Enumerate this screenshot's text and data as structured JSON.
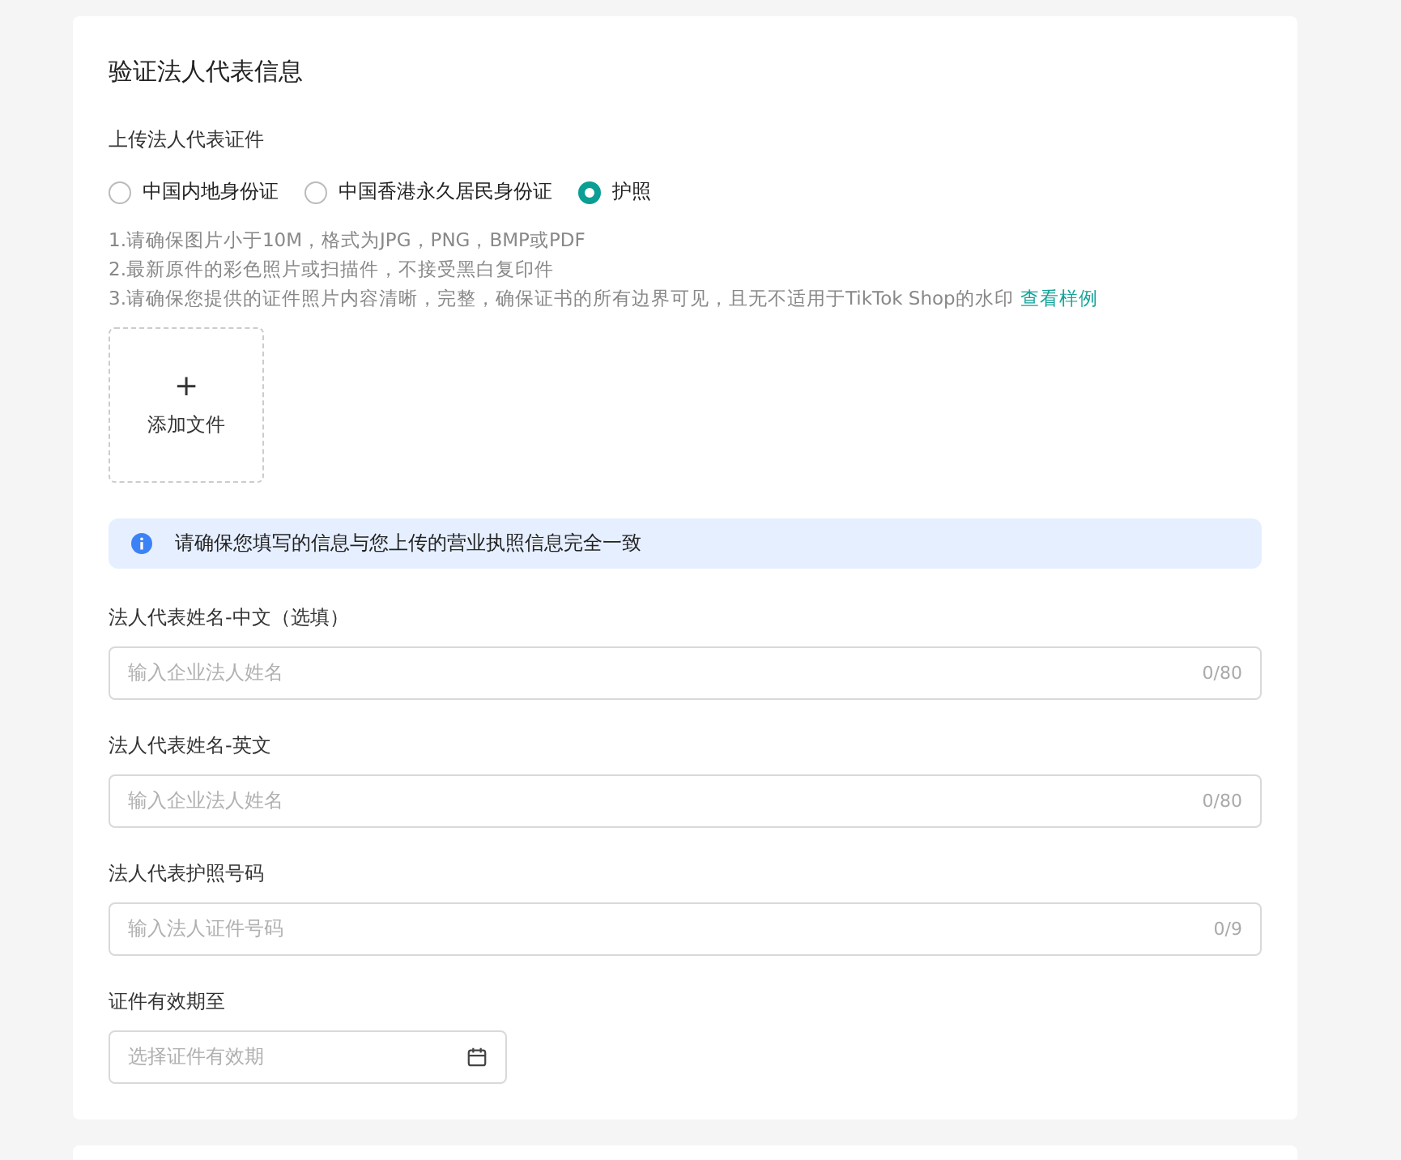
{
  "title": "验证法人代表信息",
  "upload": {
    "label": "上传法人代表证件",
    "options": [
      {
        "label": "中国内地身份证",
        "selected": false
      },
      {
        "label": "中国香港永久居民身份证",
        "selected": false
      },
      {
        "label": "护照",
        "selected": true
      }
    ],
    "notes": [
      "1.请确保图片小于10M，格式为JPG，PNG，BMP或PDF",
      "2.最新原件的彩色照片或扫描件，不接受黑白复印件",
      "3.请确保您提供的证件照片内容清晰，完整，确保证书的所有边界可见，且无不适用于TikTok Shop的水印"
    ],
    "sample_link": "查看样例",
    "add_file": {
      "icon": "+",
      "label": "添加文件"
    }
  },
  "alert": "请确保您填写的信息与您上传的营业执照信息完全一致",
  "fields": [
    {
      "kind": "text",
      "label": "法人代表姓名-中文（选填）",
      "placeholder": "输入企业法人姓名",
      "counter": "0/80"
    },
    {
      "kind": "text",
      "label": "法人代表姓名-英文",
      "placeholder": "输入企业法人姓名",
      "counter": "0/80"
    },
    {
      "kind": "text",
      "label": "法人代表护照号码",
      "placeholder": "输入法人证件号码",
      "counter": "0/9"
    },
    {
      "kind": "date",
      "label": "证件有效期至",
      "placeholder": "选择证件有效期"
    }
  ]
}
